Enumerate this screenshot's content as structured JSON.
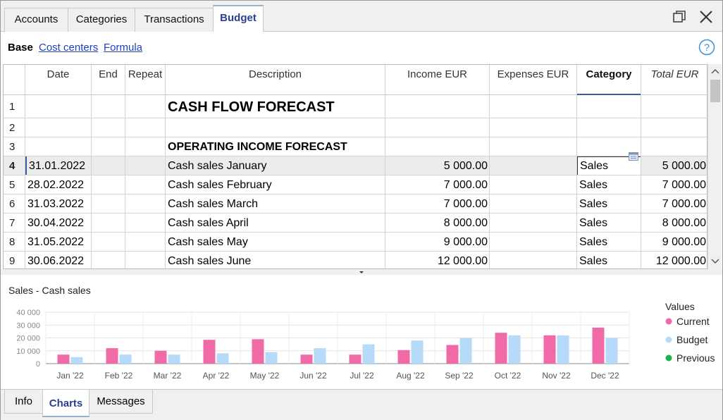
{
  "tabs": [
    {
      "label": "Accounts",
      "active": false
    },
    {
      "label": "Categories",
      "active": false
    },
    {
      "label": "Transactions",
      "active": false
    },
    {
      "label": "Budget",
      "active": true
    }
  ],
  "subnav": {
    "base": "Base",
    "cost_centers": "Cost centers",
    "formula": "Formula"
  },
  "columns": [
    "Date",
    "End",
    "Repeat",
    "Description",
    "Income EUR",
    "Expenses EUR",
    "Category",
    "Total EUR"
  ],
  "rows": [
    {
      "n": "1",
      "date": "",
      "end": "",
      "repeat": "",
      "description": "CASH FLOW FORECAST",
      "income": "",
      "expenses": "",
      "category": "",
      "total": ""
    },
    {
      "n": "2",
      "date": "",
      "end": "",
      "repeat": "",
      "description": "",
      "income": "",
      "expenses": "",
      "category": "",
      "total": ""
    },
    {
      "n": "3",
      "date": "",
      "end": "",
      "repeat": "",
      "description": "OPERATING INCOME FORECAST",
      "income": "",
      "expenses": "",
      "category": "",
      "total": ""
    },
    {
      "n": "4",
      "date": "31.01.2022",
      "end": "",
      "repeat": "",
      "description": "Cash sales January",
      "income": "5 000.00",
      "expenses": "",
      "category": "Sales",
      "total": "5 000.00"
    },
    {
      "n": "5",
      "date": "28.02.2022",
      "end": "",
      "repeat": "",
      "description": "Cash sales February",
      "income": "7 000.00",
      "expenses": "",
      "category": "Sales",
      "total": "7 000.00"
    },
    {
      "n": "6",
      "date": "31.03.2022",
      "end": "",
      "repeat": "",
      "description": "Cash sales March",
      "income": "7 000.00",
      "expenses": "",
      "category": "Sales",
      "total": "7 000.00"
    },
    {
      "n": "7",
      "date": "30.04.2022",
      "end": "",
      "repeat": "",
      "description": "Cash sales April",
      "income": "8 000.00",
      "expenses": "",
      "category": "Sales",
      "total": "8 000.00"
    },
    {
      "n": "8",
      "date": "31.05.2022",
      "end": "",
      "repeat": "",
      "description": "Cash sales May",
      "income": "9 000.00",
      "expenses": "",
      "category": "Sales",
      "total": "9 000.00"
    },
    {
      "n": "9",
      "date": "30.06.2022",
      "end": "",
      "repeat": "",
      "description": "Cash sales June",
      "income": "12 000.00",
      "expenses": "",
      "category": "Sales",
      "total": "12 000.00"
    }
  ],
  "chart_title": "Sales - Cash sales",
  "chart_data": {
    "type": "bar",
    "title": "Sales - Cash sales",
    "categories": [
      "Jan '22",
      "Feb '22",
      "Mar '22",
      "Apr '22",
      "May '22",
      "Jun '22",
      "Jul '22",
      "Aug '22",
      "Sep '22",
      "Oct '22",
      "Nov '22",
      "Dec '22"
    ],
    "series": [
      {
        "name": "Current",
        "color": "#f06aa8",
        "values": [
          7000,
          12000,
          10000,
          18500,
          19000,
          7000,
          7000,
          10500,
          14500,
          24000,
          22000,
          28000
        ]
      },
      {
        "name": "Budget",
        "color": "#b6dafa",
        "values": [
          5000,
          7000,
          7000,
          8000,
          9000,
          12000,
          15000,
          18000,
          20000,
          22000,
          22000,
          20000
        ]
      },
      {
        "name": "Previous",
        "color": "#1db34a",
        "values": []
      }
    ],
    "yticks": [
      "40 000",
      "30 000",
      "20 000",
      "10 000",
      "0"
    ],
    "ylim": [
      0,
      40000
    ],
    "legend_title": "Values",
    "legend_position": "right",
    "grid": true
  },
  "bottom_tabs": [
    {
      "label": "Info",
      "active": false
    },
    {
      "label": "Charts",
      "active": true
    },
    {
      "label": "Messages",
      "active": false
    }
  ]
}
